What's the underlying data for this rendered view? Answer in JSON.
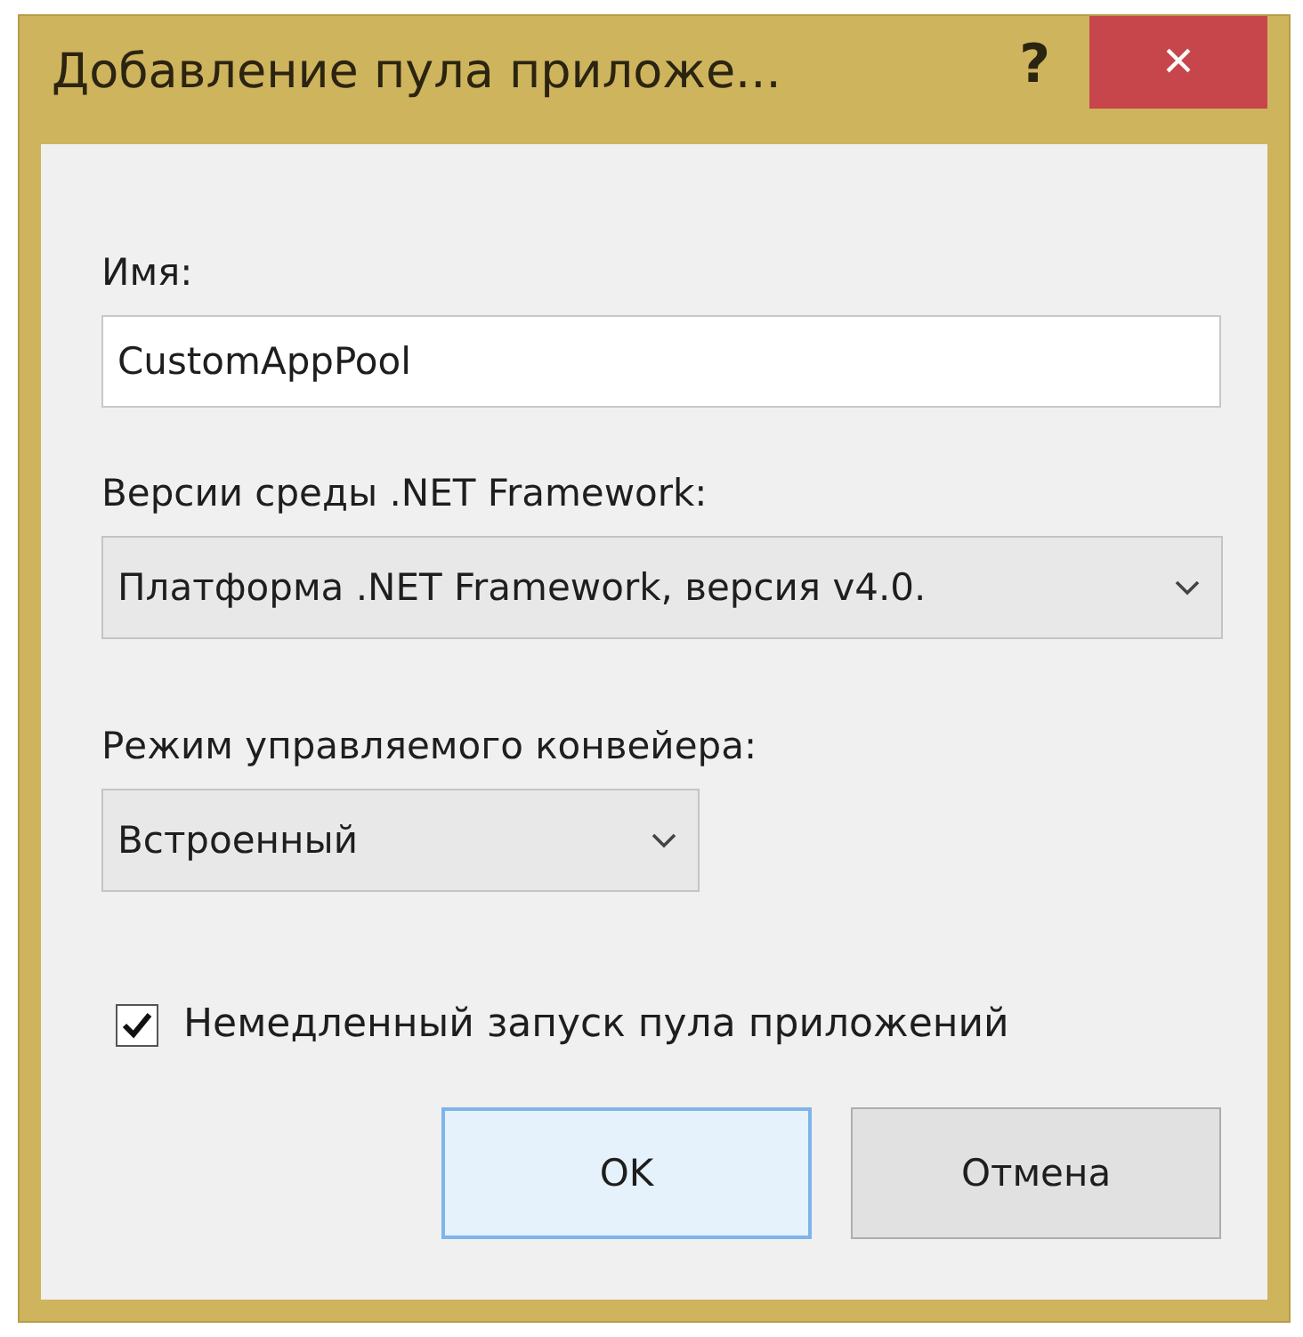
{
  "window": {
    "title": "Добавление пула приложе...",
    "help": "?",
    "close": "×"
  },
  "name_field": {
    "label": "Имя:",
    "value": "CustomAppPool"
  },
  "framework_select": {
    "label": "Версии среды .NET Framework:",
    "value": "Платформа .NET Framework, версия v4.0."
  },
  "pipeline_select": {
    "label": "Режим управляемого конвейера:",
    "value": "Встроенный"
  },
  "start_checkbox": {
    "label": "Немедленный запуск пула приложений",
    "checked": true
  },
  "buttons": [
    {
      "label": "OK",
      "default": true
    },
    {
      "label": "Отмена",
      "default": false
    }
  ]
}
